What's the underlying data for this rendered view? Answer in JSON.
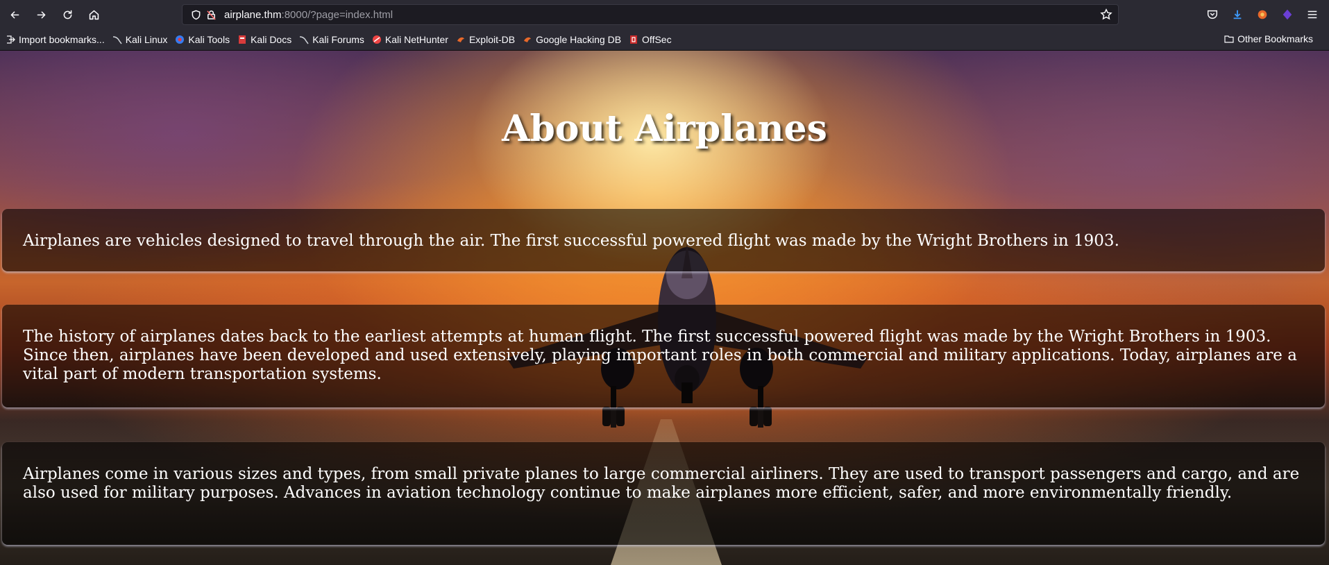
{
  "browser": {
    "url_host": "airplane.thm",
    "url_rest": ":8000/?page=index.html",
    "bookmarks": [
      {
        "label": "Import bookmarks...",
        "icon": "import-icon"
      },
      {
        "label": "Kali Linux",
        "icon": "kali-dragon-icon"
      },
      {
        "label": "Kali Tools",
        "icon": "kali-tools-icon"
      },
      {
        "label": "Kali Docs",
        "icon": "kali-docs-icon"
      },
      {
        "label": "Kali Forums",
        "icon": "kali-forums-icon"
      },
      {
        "label": "Kali NetHunter",
        "icon": "nethunter-icon"
      },
      {
        "label": "Exploit-DB",
        "icon": "exploit-db-icon"
      },
      {
        "label": "Google Hacking DB",
        "icon": "ghdb-icon"
      },
      {
        "label": "OffSec",
        "icon": "offsec-icon"
      }
    ],
    "other_bookmarks": "Other Bookmarks"
  },
  "page": {
    "title": "About Airplanes",
    "paragraphs": [
      "Airplanes are vehicles designed to travel through the air. The first successful powered flight was made by the Wright Brothers in 1903.",
      "The history of airplanes dates back to the earliest attempts at human flight. The first successful powered flight was made by the Wright Brothers in 1903. Since then, airplanes have been developed and used extensively, playing important roles in both commercial and military applications. Today, airplanes are a vital part of modern transportation systems.",
      "Airplanes come in various sizes and types, from small private planes to large commercial airliners. They are used to transport passengers and cargo, and are also used for military purposes. Advances in aviation technology continue to make airplanes more efficient, safer, and more environmentally friendly."
    ]
  },
  "colors": {
    "chrome": "#2b2a33",
    "urlbar": "#1c1b22",
    "text": "#fbfbfe"
  }
}
